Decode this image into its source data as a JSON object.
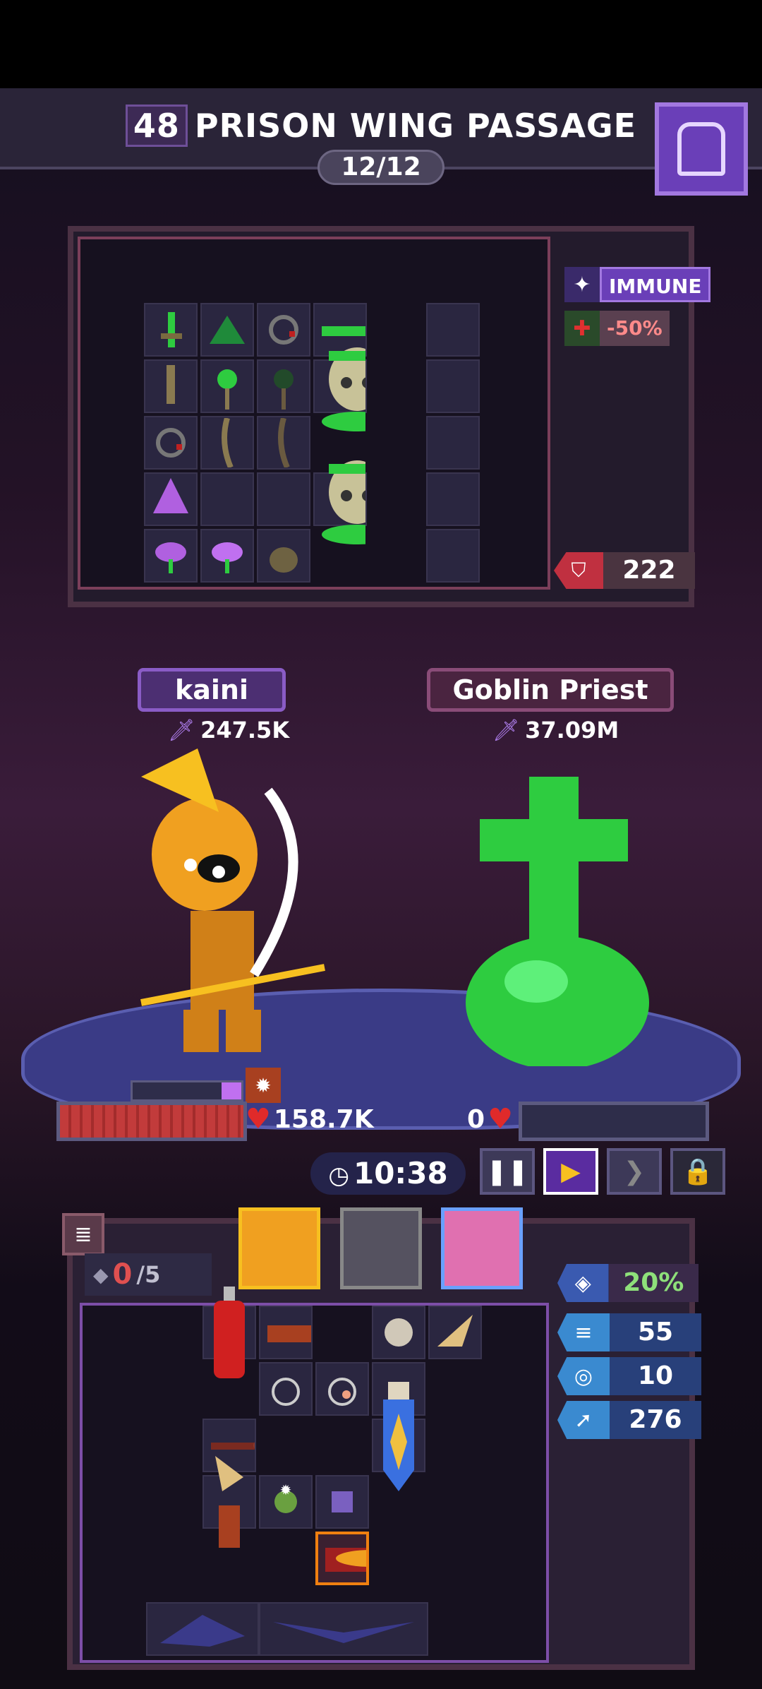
{
  "header": {
    "level": "48",
    "title": "PRISON WING PASSAGE",
    "progress": "12/12"
  },
  "enemy_panel": {
    "statuses": [
      {
        "icon": "immune-icon",
        "label": "IMMUNE"
      },
      {
        "icon": "heal-reduction-icon",
        "label": "-50%"
      }
    ],
    "armor_value": "222"
  },
  "player": {
    "name": "kaini",
    "power": "247.5K",
    "hp": "158.7K",
    "hp_fraction": 1.0
  },
  "enemy": {
    "name": "Goblin Priest",
    "power": "37.09M",
    "hp": "0",
    "hp_fraction": 0.0
  },
  "battle_controls": {
    "timer": "10:38",
    "pause_icon": "pause-icon",
    "play_icon": "play-icon",
    "fast_forward_icon": "fast-forward-icon",
    "lock_icon": "lock-icon"
  },
  "player_panel": {
    "gems_current": "0",
    "gems_max": "/5",
    "stats": [
      {
        "icon": "crit-icon",
        "value": "20%",
        "color": "#3a2a4a"
      },
      {
        "icon": "damage-icon",
        "value": "55",
        "color": "#28407a"
      },
      {
        "icon": "defense-icon",
        "value": "10",
        "color": "#28407a"
      },
      {
        "icon": "speed-icon",
        "value": "276",
        "color": "#28407a"
      }
    ]
  },
  "colors": {
    "accent_purple": "#6a3fb8",
    "hp_red": "#c23b3b",
    "stat_blue": "#28407a",
    "crit_green": "#8ee07a"
  }
}
